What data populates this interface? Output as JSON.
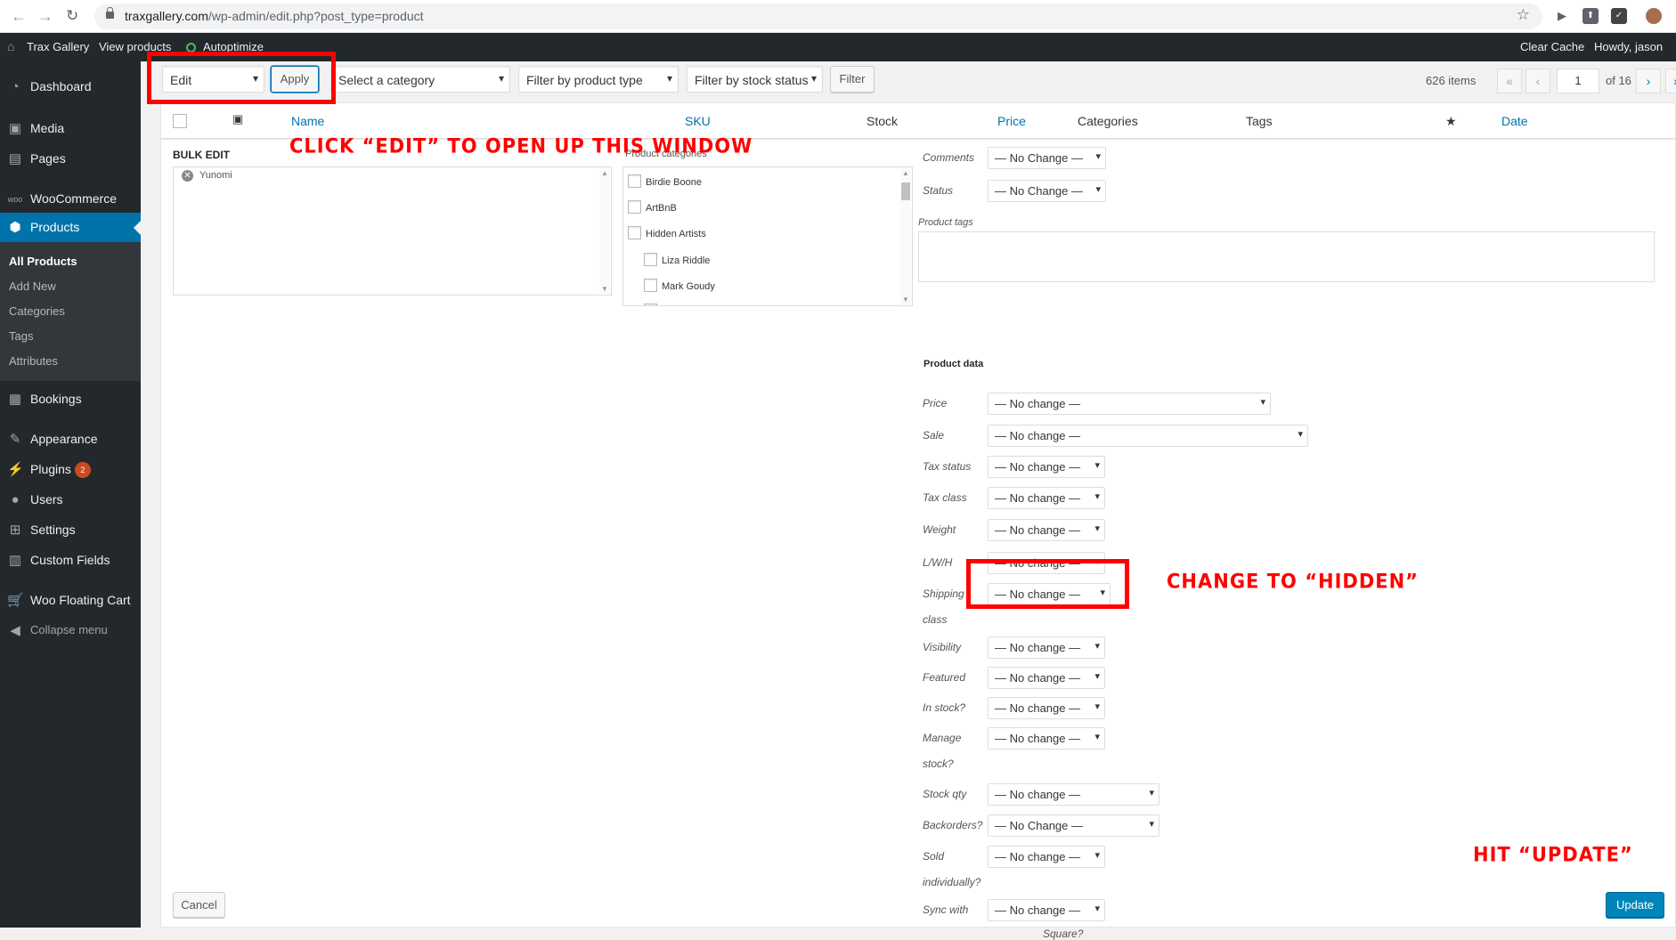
{
  "browser": {
    "url_host": "traxgallery.com",
    "url_path": "/wp-admin/edit.php?post_type=product",
    "back_icon": "arrow-left-icon",
    "forward_icon": "arrow-right-icon",
    "reload_icon": "reload-icon",
    "star_icon": "star-icon"
  },
  "adminbar": {
    "site_name": "Trax Gallery",
    "view_products": "View products",
    "autoptimize": "Autoptimize",
    "clear_cache": "Clear Cache",
    "howdy": "Howdy, jason"
  },
  "sidebar": {
    "dashboard": "Dashboard",
    "media": "Media",
    "pages": "Pages",
    "woocommerce": "WooCommerce",
    "products": "Products",
    "sub": {
      "all_products": "All Products",
      "add_new": "Add New",
      "categories": "Categories",
      "tags": "Tags",
      "attributes": "Attributes"
    },
    "bookings": "Bookings",
    "appearance": "Appearance",
    "plugins": "Plugins",
    "plugins_badge": "2",
    "users": "Users",
    "settings": "Settings",
    "custom_fields": "Custom Fields",
    "woo_floating_cart": "Woo Floating Cart",
    "collapse": "Collapse menu"
  },
  "toolbar": {
    "bulk_action": "Edit",
    "apply": "Apply",
    "category": "Select a category",
    "product_type": "Filter by product type",
    "stock_status": "Filter by stock status",
    "filter": "Filter",
    "items_count": "626 items",
    "first_page": "«",
    "prev_page": "‹",
    "current_page": "1",
    "total_pages": "of 16",
    "next_page": "›",
    "last_page": "»"
  },
  "table": {
    "columns": {
      "name": "Name",
      "sku": "SKU",
      "stock": "Stock",
      "price": "Price",
      "categories": "Categories",
      "tags": "Tags",
      "featured": "★",
      "date": "Date"
    }
  },
  "bulk_edit": {
    "title": "BULK EDIT",
    "items": [
      "Yunomi"
    ],
    "categories_label": "Product categories",
    "categories": [
      "Birdie Boone",
      "ArtBnB",
      "Hidden Artists",
      "Liza Riddle",
      "Mark Goudy"
    ],
    "comments_label": "Comments",
    "comments_value": "— No Change —",
    "status_label": "Status",
    "status_value": "— No Change —",
    "product_tags_label": "Product tags",
    "product_data_label": "Product data",
    "fields": {
      "price": {
        "label": "Price",
        "value": "— No change —"
      },
      "sale": {
        "label": "Sale",
        "value": "— No change —"
      },
      "tax_status": {
        "label": "Tax status",
        "value": "— No change —"
      },
      "tax_class": {
        "label": "Tax class",
        "value": "— No change —"
      },
      "weight": {
        "label": "Weight",
        "value": "— No change —"
      },
      "lwh": {
        "label": "L/W/H",
        "value": "— No change —"
      },
      "shipping_1": {
        "label": "Shipping",
        "value": "— No change —"
      },
      "shipping_2": {
        "label": "class"
      },
      "visibility": {
        "label": "Visibility",
        "value": "— No change —"
      },
      "featured": {
        "label": "Featured",
        "value": "— No change —"
      },
      "in_stock": {
        "label": "In stock?",
        "value": "— No change —"
      },
      "manage_1": {
        "label": "Manage",
        "value": "— No change —"
      },
      "manage_2": {
        "label": "stock?"
      },
      "stock_qty": {
        "label": "Stock qty",
        "value": "— No change —"
      },
      "backorders": {
        "label": "Backorders?",
        "value": "— No Change —"
      },
      "sold_1": {
        "label": "Sold",
        "value": "— No change —"
      },
      "sold_2": {
        "label": "individually?"
      },
      "sync_1": {
        "label": "Sync with",
        "value": "— No change —"
      },
      "sync_2": {
        "label": "Square?"
      }
    },
    "cancel": "Cancel",
    "update": "Update"
  },
  "annotations": {
    "click_edit": "CLICK “EDIT” TO OPEN UP THIS WINDOW",
    "change_hidden": "CHANGE TO “HIDDEN”",
    "hit_update": "HIT “UPDATE”",
    "color": "#ff0000"
  },
  "colors": {
    "admin_bg": "#23282d",
    "accent": "#0073aa",
    "link": "#0073aa"
  }
}
